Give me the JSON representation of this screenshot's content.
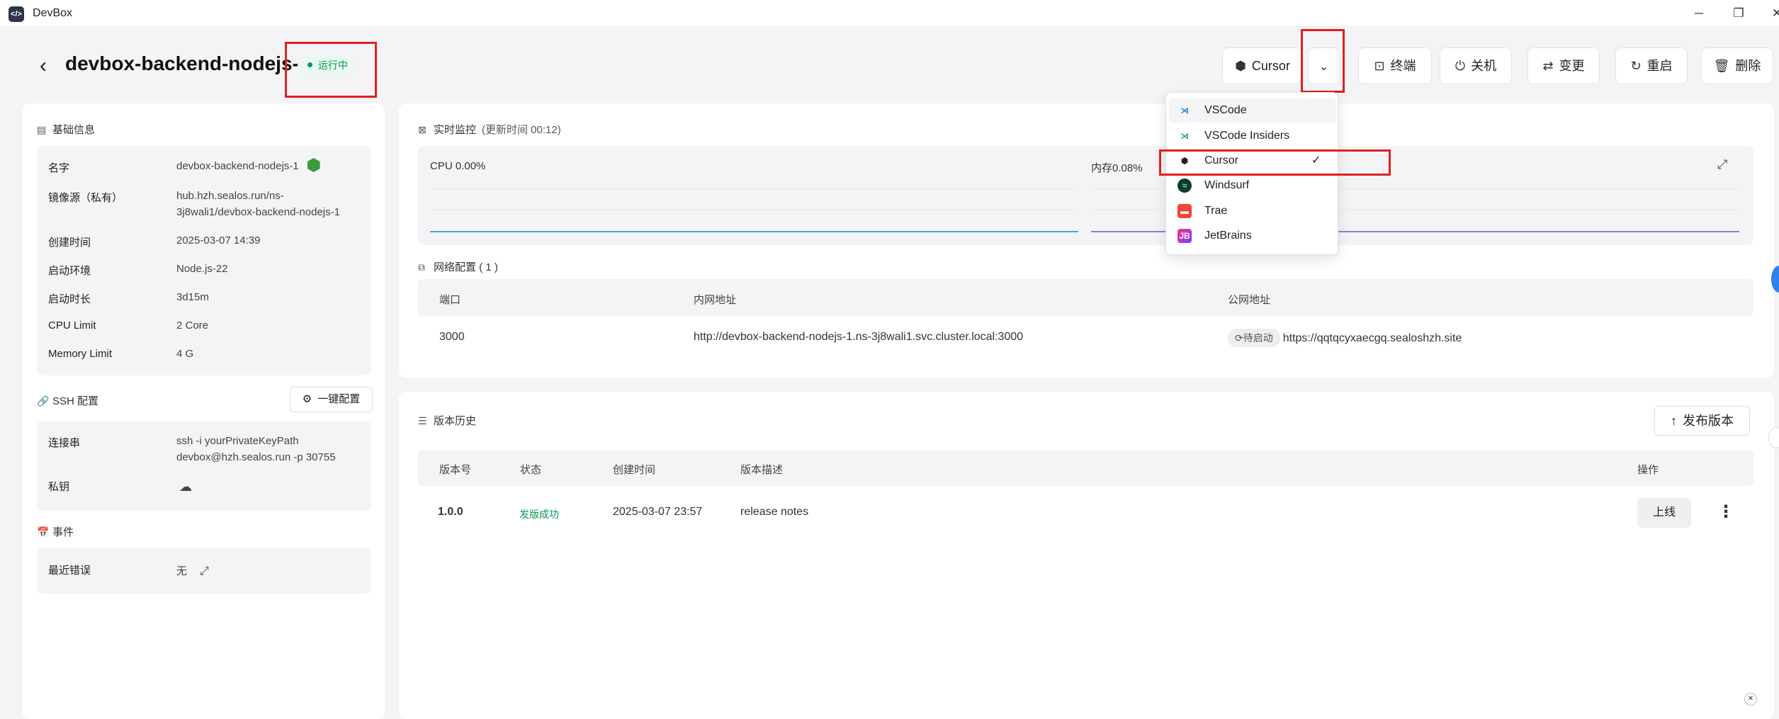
{
  "app": {
    "title": "DevBox",
    "icon": "devbox-logo-icon"
  },
  "window_controls": {
    "minimize": "─",
    "maximize": "❐",
    "close": "✕"
  },
  "header": {
    "back": "‹",
    "title": "devbox-backend-nodejs-1",
    "status": "运行中",
    "ide_button": "Cursor",
    "terminal": "终端",
    "shutdown": "关机",
    "change": "变更",
    "restart": "重启",
    "delete": "删除"
  },
  "basic_info": {
    "title": "基础信息",
    "rows": [
      {
        "label": "名字",
        "value": "devbox-backend-nodejs-1"
      },
      {
        "label": "镜像源（私有）",
        "value": "hub.hzh.sealos.run/ns-",
        "value2": "3j8wali1/devbox-backend-nodejs-1"
      },
      {
        "label": "创建时间",
        "value": "2025-03-07 14:39"
      },
      {
        "label": "启动环境",
        "value": "Node.js-22"
      },
      {
        "label": "启动时长",
        "value": "3d15m"
      },
      {
        "label": "CPU Limit",
        "value": "2 Core"
      },
      {
        "label": "Memory Limit",
        "value": "4 G"
      }
    ]
  },
  "ssh": {
    "title": "SSH 配置",
    "one_click": "一键配置",
    "conn_label": "连接串",
    "conn_value1": "ssh -i yourPrivateKeyPath",
    "conn_value2": "devbox@hzh.sealos.run -p 30755",
    "key_label": "私钥"
  },
  "events": {
    "title": "事件",
    "last_error_label": "最近错误",
    "last_error_value": "无"
  },
  "monitor": {
    "title": "实时监控",
    "updated": "(更新时间  00:12)",
    "cpu": "CPU 0.00%",
    "memory": "内存0.08%",
    "cpu_color": "#4aa8d8",
    "memory_color": "#8a7fd0"
  },
  "network": {
    "title": "网络配置 ( 1 )",
    "columns": [
      "端口",
      "内网地址",
      "公网地址"
    ],
    "row": {
      "port": "3000",
      "internal": "http://devbox-backend-nodejs-1.ns-3j8wali1.svc.cluster.local:3000",
      "public_status": "待启动",
      "public": "https://qqtqcyxaecgq.sealoshzh.site"
    }
  },
  "versions": {
    "title": "版本历史",
    "publish": "发布版本",
    "columns": [
      "版本号",
      "状态",
      "创建时间",
      "版本描述",
      "操作"
    ],
    "row": {
      "version": "1.0.0",
      "status": "发版成功",
      "created": "2025-03-07 23:57",
      "desc": "release notes",
      "action": "上线"
    }
  },
  "ide_menu": {
    "items": [
      {
        "label": "VSCode",
        "icon": "vscode-icon"
      },
      {
        "label": "VSCode Insiders",
        "icon": "vscode-insiders-icon"
      },
      {
        "label": "Cursor",
        "icon": "cursor-icon",
        "selected": true
      },
      {
        "label": "Windsurf",
        "icon": "windsurf-icon"
      },
      {
        "label": "Trae",
        "icon": "trae-icon"
      },
      {
        "label": "JetBrains",
        "icon": "jetbrains-icon"
      }
    ]
  },
  "colors": {
    "accent_red": "#e02020",
    "success": "#039855"
  }
}
